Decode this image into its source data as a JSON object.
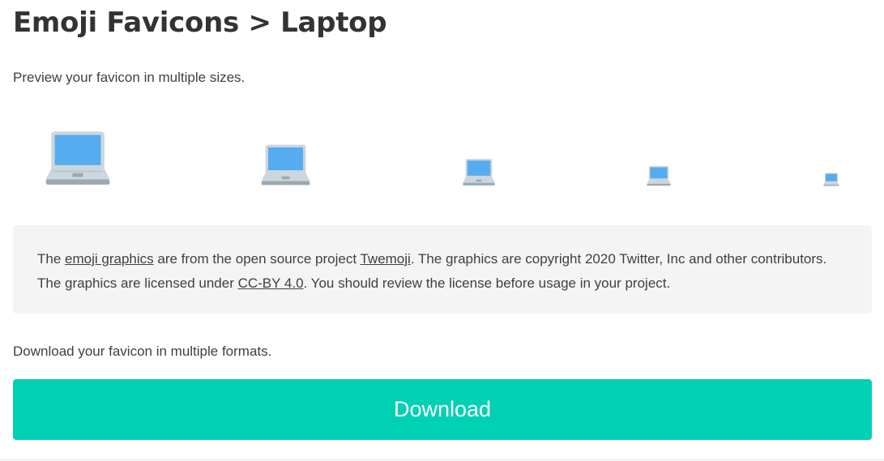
{
  "header": {
    "title": "Emoji Favicons > Laptop"
  },
  "preview": {
    "intro": "Preview your favicon in multiple sizes.",
    "icon_name": "laptop-icon"
  },
  "notice": {
    "text_1": "The ",
    "link_emoji_graphics": "emoji graphics",
    "text_2": " are from the open source project ",
    "link_twemoji": "Twemoji",
    "text_3": ". The graphics are copyright 2020 Twitter, Inc and other contributors. The graphics are licensed under ",
    "link_license": "CC-BY 4.0",
    "text_4": ". You should review the license before usage in your project."
  },
  "download": {
    "intro": "Download your favicon in multiple formats.",
    "button_label": "Download"
  },
  "colors": {
    "accent": "#00d1b2",
    "notice_bg": "#f4f4f4",
    "laptop_body": "#ccd6dd",
    "laptop_base": "#99aab5",
    "laptop_screen": "#55acee"
  }
}
